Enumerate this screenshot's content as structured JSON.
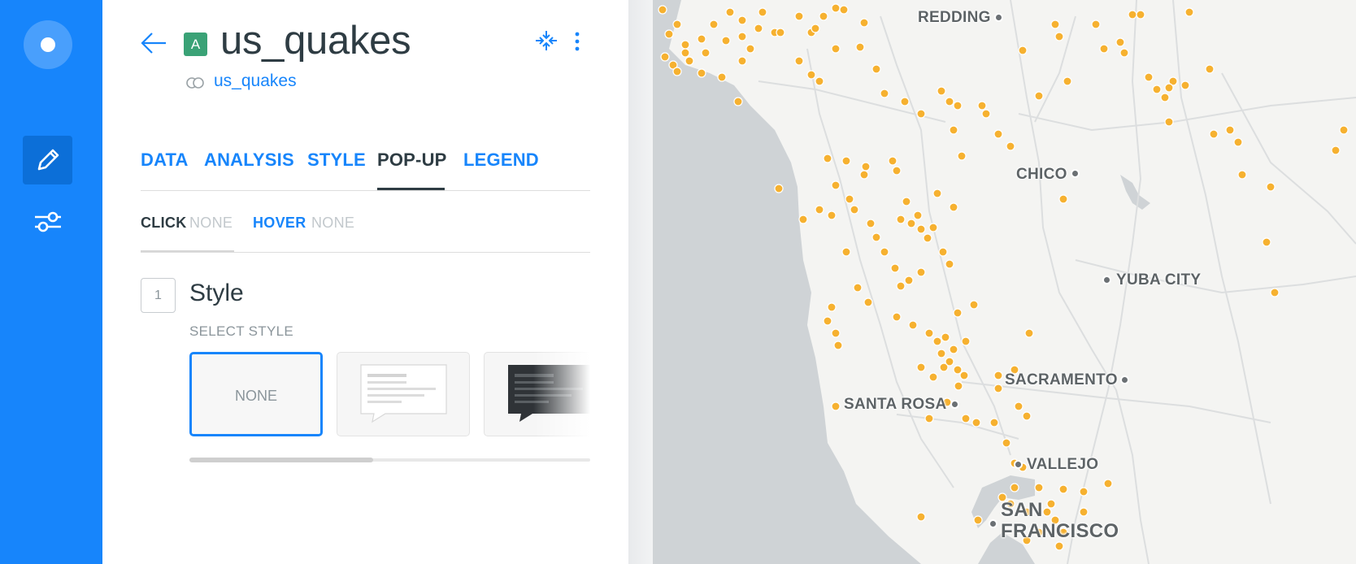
{
  "layer": {
    "badge": "A",
    "title": "us_quakes",
    "source": "us_quakes"
  },
  "tabs": [
    {
      "label": "DATA"
    },
    {
      "label": "ANALYSIS"
    },
    {
      "label": "STYLE"
    },
    {
      "label": "POP-UP"
    },
    {
      "label": "LEGEND"
    }
  ],
  "active_tab": "POP-UP",
  "popup_subtabs": {
    "click_label": "CLICK",
    "click_value": "NONE",
    "hover_label": "HOVER",
    "hover_value": "NONE"
  },
  "style_section": {
    "step": "1",
    "title": "Style",
    "select_label": "SELECT STYLE",
    "options": [
      {
        "label": "NONE",
        "selected": true
      },
      {
        "label": "",
        "selected": false,
        "icon": "light-popup-preview-icon"
      },
      {
        "label": "",
        "selected": false,
        "icon": "dark-popup-preview-icon"
      }
    ]
  },
  "icons": {
    "logo": "carto-logo-icon",
    "edit": "pencil-icon",
    "settings": "sliders-icon",
    "back": "arrow-left-icon",
    "collapse": "collapse-icon",
    "more": "kebab-menu-icon",
    "source": "dataset-icon"
  },
  "colors": {
    "brand": "#1785fb",
    "badge": "#3aa276",
    "point": "#f6b130",
    "text_dark": "#2e3c43"
  },
  "map": {
    "cities": [
      {
        "name": "REDDING"
      },
      {
        "name": "CHICO"
      },
      {
        "name": "YUBA CITY"
      },
      {
        "name": "SACRAMENTO"
      },
      {
        "name": "SANTA ROSA"
      },
      {
        "name": "VALLEJO"
      },
      {
        "name": "SAN"
      },
      {
        "name": "FRANCISCO"
      }
    ]
  }
}
